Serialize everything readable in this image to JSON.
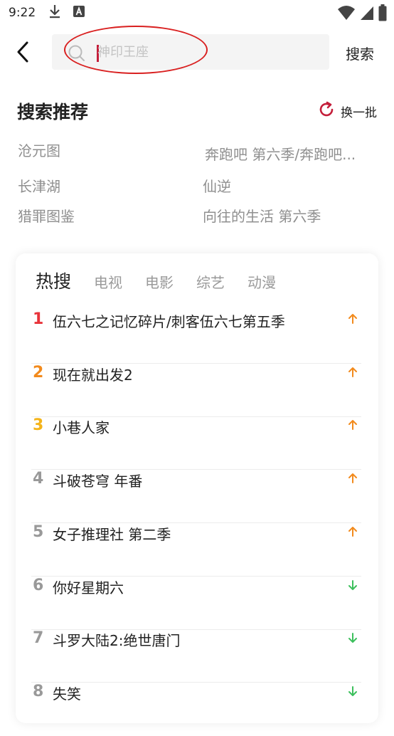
{
  "status_bar": {
    "time": "9:22",
    "icons_left": [
      "download-icon",
      "a-icon"
    ],
    "icons_right": [
      "wifi-icon",
      "signal-icon",
      "battery-icon"
    ]
  },
  "search": {
    "placeholder": "神印王座",
    "button_label": "搜索",
    "annotation_color": "#d92020",
    "cursor_color": "#c41e3a"
  },
  "recommend": {
    "title": "搜索推荐",
    "refresh_label": "换一批",
    "refresh_color": "#c41e3a",
    "items": [
      "沧元图",
      "奔跑吧 第六季/奔跑吧...",
      "长津湖",
      "仙逆",
      "猎罪图鉴",
      "向往的生活 第六季"
    ]
  },
  "hot": {
    "tabs": [
      "热搜",
      "电视",
      "电影",
      "综艺",
      "动漫"
    ],
    "rank_colors": {
      "1": "#e8333a",
      "2": "#f28a1c",
      "3": "#f4b41a",
      "other": "#999999"
    },
    "trend_colors": {
      "up": "#f28a1c",
      "down": "#3cbf5c"
    },
    "items": [
      {
        "rank": "1",
        "title": "伍六七之记忆碎片/刺客伍六七第五季",
        "trend": "up"
      },
      {
        "rank": "2",
        "title": "现在就出发2",
        "trend": "up"
      },
      {
        "rank": "3",
        "title": "小巷人家",
        "trend": "up"
      },
      {
        "rank": "4",
        "title": "斗破苍穹 年番",
        "trend": "up"
      },
      {
        "rank": "5",
        "title": "女子推理社 第二季",
        "trend": "up"
      },
      {
        "rank": "6",
        "title": "你好星期六",
        "trend": "down"
      },
      {
        "rank": "7",
        "title": "斗罗大陆2:绝世唐门",
        "trend": "down"
      },
      {
        "rank": "8",
        "title": "失笑",
        "trend": "down"
      }
    ]
  }
}
